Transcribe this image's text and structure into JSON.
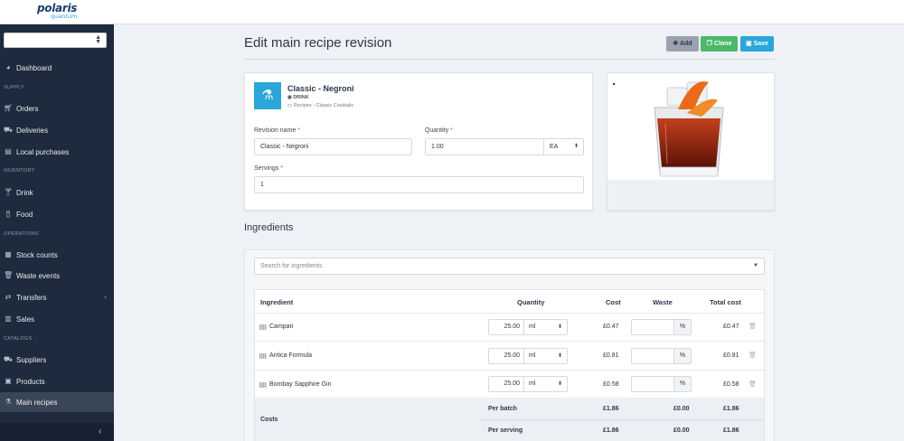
{
  "brand": {
    "name": "polaris",
    "sub": "quantum"
  },
  "sidebar": {
    "selector_value": "",
    "sections": {
      "supply": "SUPPLY",
      "inventory": "INVENTORY",
      "operations": "OPERATIONS",
      "catalogs": "CATALOGS"
    },
    "items": {
      "dashboard": "Dashboard",
      "orders": "Orders",
      "deliveries": "Deliveries",
      "local_purchases": "Local purchases",
      "drink": "Drink",
      "food": "Food",
      "stock_counts": "Stock counts",
      "waste_events": "Waste events",
      "transfers": "Transfers",
      "sales": "Sales",
      "suppliers": "Suppliers",
      "products": "Products",
      "main_recipes": "Main recipes"
    },
    "active": "main_recipes"
  },
  "page": {
    "title": "Edit main recipe revision",
    "buttons": {
      "add": "Add",
      "clone": "Clone",
      "save": "Save"
    }
  },
  "recipe": {
    "name": "Classic - Negroni",
    "type": "DRINK",
    "path": "Recipes › Classic Cocktails",
    "labels": {
      "revision_name": "Revision name",
      "quantity": "Quantity",
      "servings": "Servings",
      "required_mark": "*"
    },
    "revision_name": "Classic - Negroni",
    "quantity": "1.00",
    "unit": "EA",
    "servings": "1"
  },
  "ingredients": {
    "title": "Ingredients",
    "search_placeholder": "Search for ingredients",
    "columns": {
      "ingredient": "Ingredient",
      "quantity": "Quantity",
      "cost": "Cost",
      "waste": "Waste",
      "total_cost": "Total cost"
    },
    "percent_sign": "%",
    "rows": [
      {
        "name": "Campari",
        "qty": "25.00",
        "unit": "ml",
        "cost": "£0.47",
        "waste": "",
        "total": "£0.47"
      },
      {
        "name": "Antica Formula",
        "qty": "25.00",
        "unit": "ml",
        "cost": "£0.81",
        "waste": "",
        "total": "£0.81"
      },
      {
        "name": "Bombay Sapphire Gin",
        "qty": "25.00",
        "unit": "ml",
        "cost": "£0.58",
        "waste": "",
        "total": "£0.58"
      }
    ],
    "costs": {
      "label": "Costs",
      "per_batch": {
        "label": "Per batch",
        "cost": "£1.86",
        "waste": "£0.00",
        "total": "£1.86"
      },
      "per_serving": {
        "label": "Per serving",
        "cost": "£1.86",
        "waste": "£0.00",
        "total": "£1.86"
      }
    }
  },
  "colors": {
    "accent": "#2aa6d8",
    "sidebar": "#1e2a3d",
    "clone": "#4cb86a",
    "add": "#9aa3ad"
  }
}
